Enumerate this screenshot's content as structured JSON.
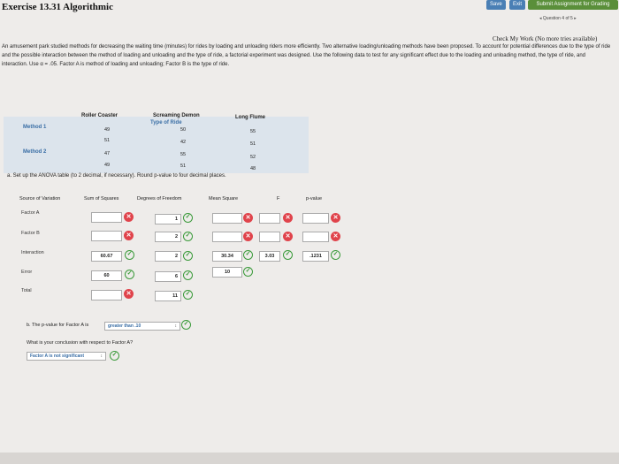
{
  "header": {
    "title": "Exercise 13.31 Algorithmic",
    "save_label": "Save",
    "exit_label": "Exit",
    "submit_label": "Submit Assignment for Grading",
    "question_nav": "Question 4 of 5"
  },
  "check_work": "Check My Work (No more tries available)",
  "problem_text": "An amusement park studied methods for decreasing the waiting time (minutes) for rides by loading and unloading riders more efficiently. Two alternative loading/unloading methods have been proposed. To account for potential differences due to the type of ride and the possible interaction between the method of loading and unloading and the type of ride, a factorial experiment was designed. Use the following data to test for any significant effect due to the loading and unloading method, the type of ride, and interaction. Use α = .05. Factor A is method of loading and unloading; Factor B is the type of ride.",
  "data_table": {
    "title": "Type of Ride",
    "columns": [
      "Roller Coaster",
      "Screaming Demon",
      "Long Flume"
    ],
    "rows": [
      {
        "label": "Method 1",
        "values": [
          "49",
          "50",
          "55"
        ]
      },
      {
        "label": "",
        "values": [
          "51",
          "42",
          "51"
        ]
      },
      {
        "label": "Method 2",
        "values": [
          "47",
          "55",
          "52"
        ]
      },
      {
        "label": "",
        "values": [
          "49",
          "51",
          "48"
        ]
      }
    ]
  },
  "part_a": "a. Set up the ANOVA table (to 2 decimal, if necessary). Round p-value to four decimal places.",
  "anova": {
    "headers": [
      "Source of Variation",
      "Sum of Squares",
      "Degrees of Freedom",
      "Mean Square",
      "F",
      "p-value"
    ],
    "rows": [
      {
        "label": "Factor A",
        "ss": "",
        "df": "1",
        "ms": "",
        "f": "",
        "p": ""
      },
      {
        "label": "Factor B",
        "ss": "",
        "df": "2",
        "ms": "",
        "f": "",
        "p": ""
      },
      {
        "label": "Interaction",
        "ss": "60.67",
        "df": "2",
        "ms": "30.34",
        "f": "3.03",
        "p": ".1231"
      },
      {
        "label": "Error",
        "ss": "60",
        "df": "6",
        "ms": "10",
        "f": "",
        "p": ""
      },
      {
        "label": "Total",
        "ss": "",
        "df": "11",
        "ms": "",
        "f": "",
        "p": ""
      }
    ]
  },
  "part_b": {
    "prefix": "b. The p-value for Factor A is",
    "dropdown_value": "greater than .10",
    "question": "What is your conclusion with respect to Factor A?",
    "conclusion_value": "Factor A is not significant"
  },
  "colors": {
    "accent": "#3a6ea5",
    "error": "#e0434b",
    "ok": "#3a9a3a"
  }
}
